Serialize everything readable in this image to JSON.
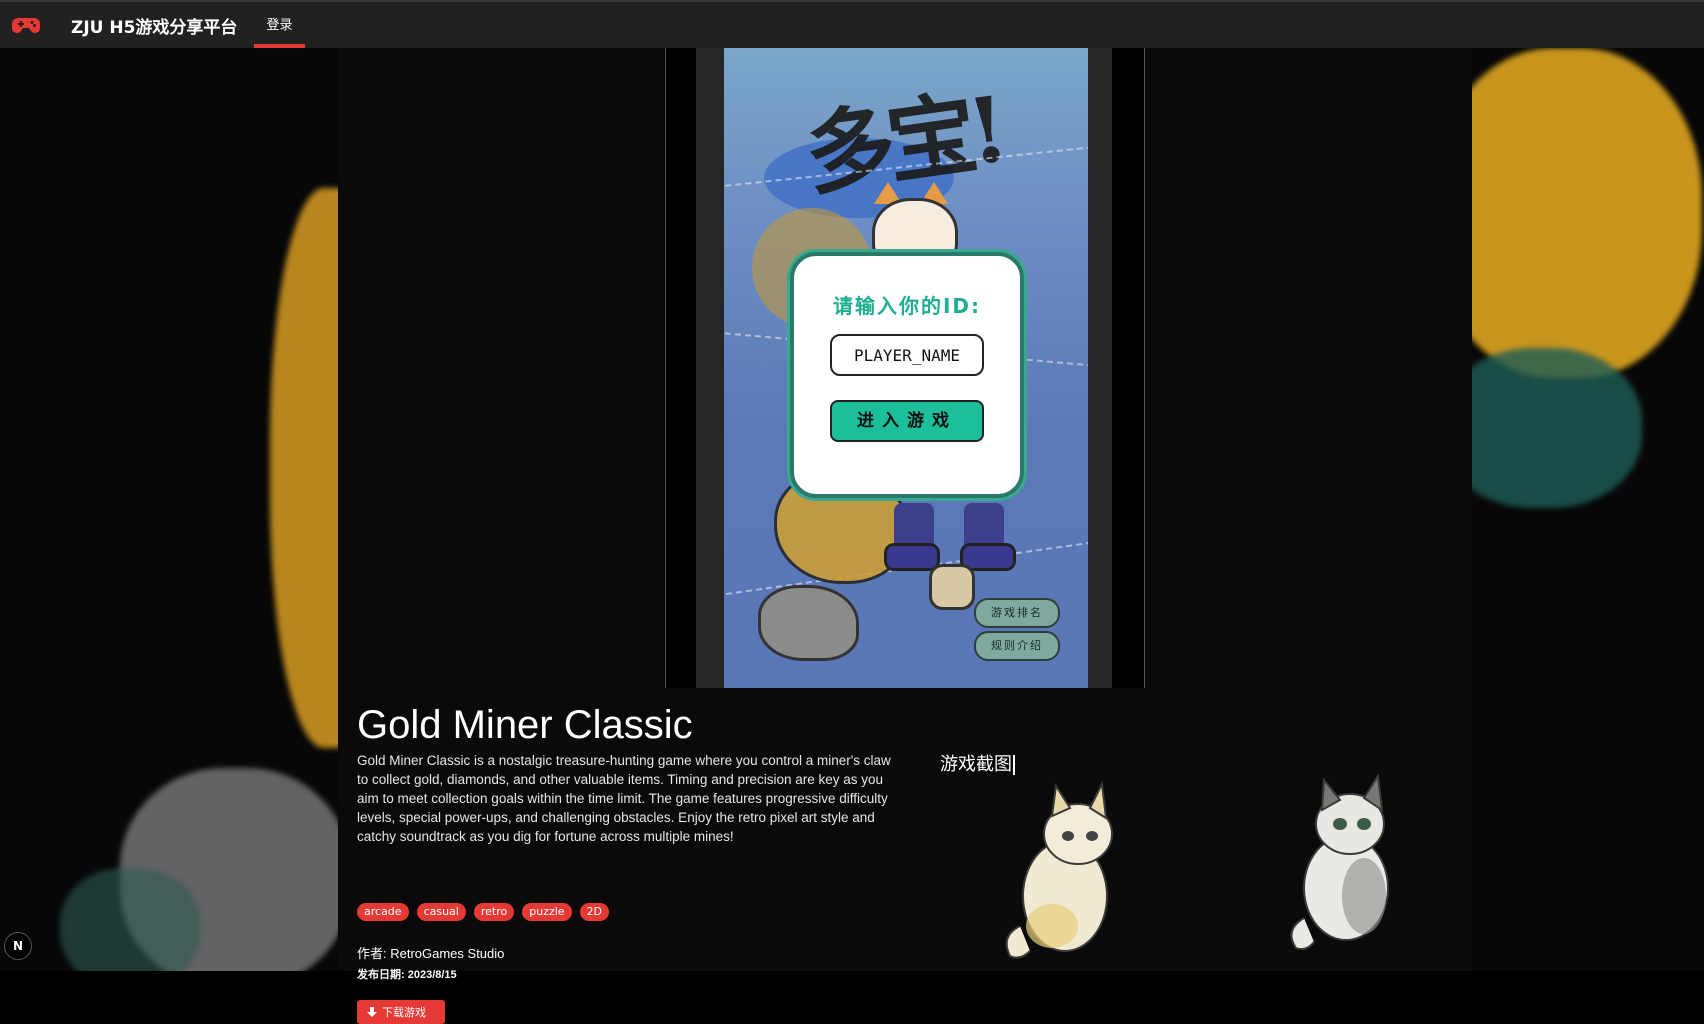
{
  "header": {
    "brand_title": "ZJU H5游戏分享平台",
    "nav_login": "登录",
    "logo_icon": "gamepad-icon",
    "accent_color": "#e53935"
  },
  "game_preview": {
    "dialog_title": "请输入你的ID:",
    "player_input_value": "PLAYER_NAME",
    "enter_button": "进入游戏",
    "ranking_button": "游戏排名",
    "rules_button": "规则介绍",
    "primary_color": "#1bbf9a"
  },
  "game": {
    "name": "Gold Miner Classic",
    "description": "Gold Miner Classic is a nostalgic treasure-hunting game where you control a miner's claw to collect gold, diamonds, and other valuable items. Timing and precision are key as you aim to meet collection goals within the time limit. The game features progressive difficulty levels, special power-ups, and challenging obstacles. Enjoy the retro pixel art style and catchy soundtrack as you dig for fortune across multiple mines!",
    "tags": [
      "arcade",
      "casual",
      "retro",
      "puzzle",
      "2D"
    ],
    "author": "作者: RetroGames Studio",
    "release_date": "发布日期: 2023/8/15",
    "download_button": "下载游戏",
    "download_icon": "download-icon"
  },
  "screenshots": {
    "title": "游戏截图"
  },
  "dev_badge": "N"
}
